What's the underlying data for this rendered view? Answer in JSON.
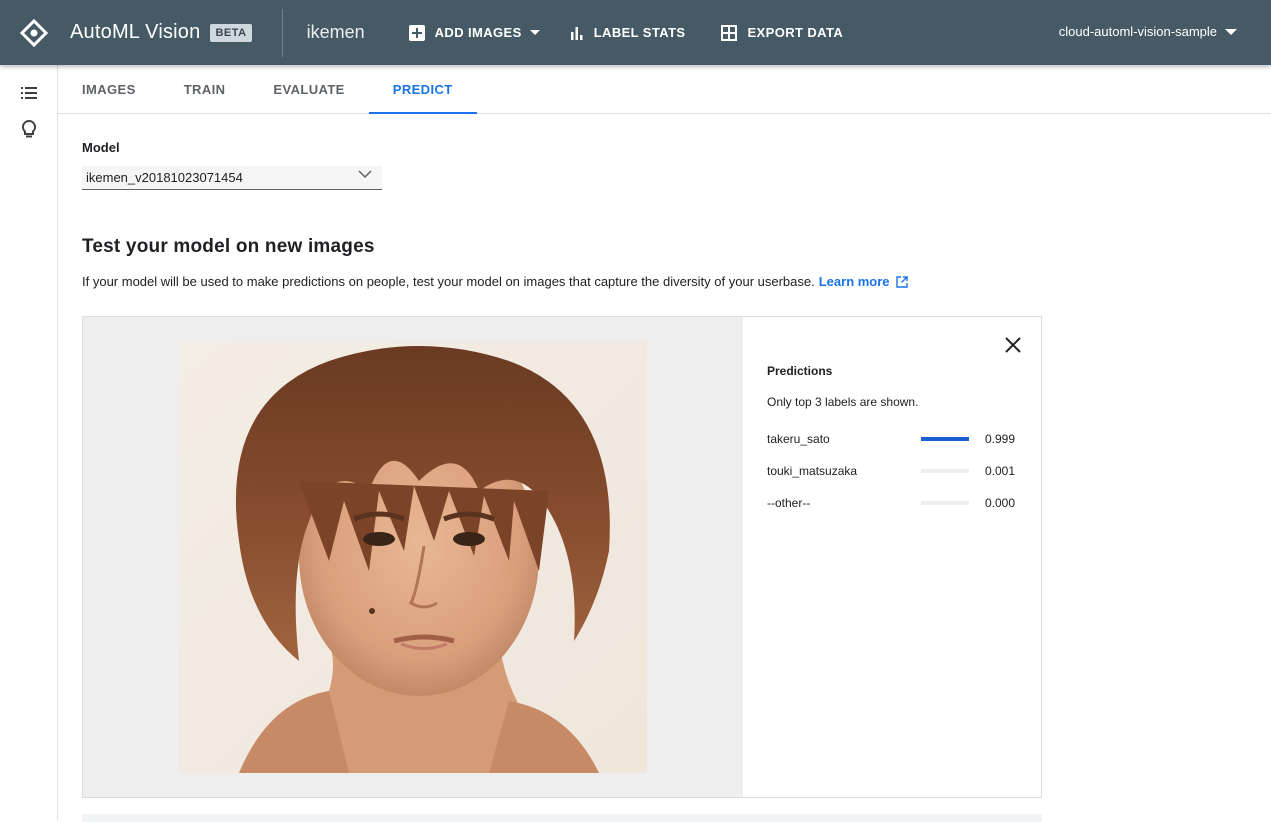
{
  "app": {
    "title": "AutoML Vision",
    "badge": "BETA",
    "dataset": "ikemen",
    "project": "cloud-automl-vision-sample"
  },
  "toolbar": {
    "add_images": "ADD IMAGES",
    "label_stats": "LABEL STATS",
    "export_data": "EXPORT DATA"
  },
  "rail": {
    "icons": [
      "list-icon",
      "lightbulb-icon"
    ]
  },
  "tabs": [
    {
      "label": "IMAGES"
    },
    {
      "label": "TRAIN"
    },
    {
      "label": "EVALUATE"
    },
    {
      "label": "PREDICT"
    }
  ],
  "active_tab": "PREDICT",
  "model": {
    "label": "Model",
    "selected": "ikemen_v20181023071454"
  },
  "test_section": {
    "title": "Test your model on new images",
    "description": "If your model will be used to make predictions on people, test your model on images that capture the diversity of your userbase.",
    "learn_more": "Learn more"
  },
  "predictions": {
    "title": "Predictions",
    "note": "Only top 3 labels are shown.",
    "items": [
      {
        "label": "takeru_sato",
        "score": "0.999",
        "value": 0.999
      },
      {
        "label": "touki_matsuzaka",
        "score": "0.001",
        "value": 0.001
      },
      {
        "label": "--other--",
        "score": "0.000",
        "value": 0.0
      }
    ]
  },
  "colors": {
    "appbar": "#455a64",
    "accent": "#1a73e8",
    "bar_fill": "#1a5fd1"
  }
}
